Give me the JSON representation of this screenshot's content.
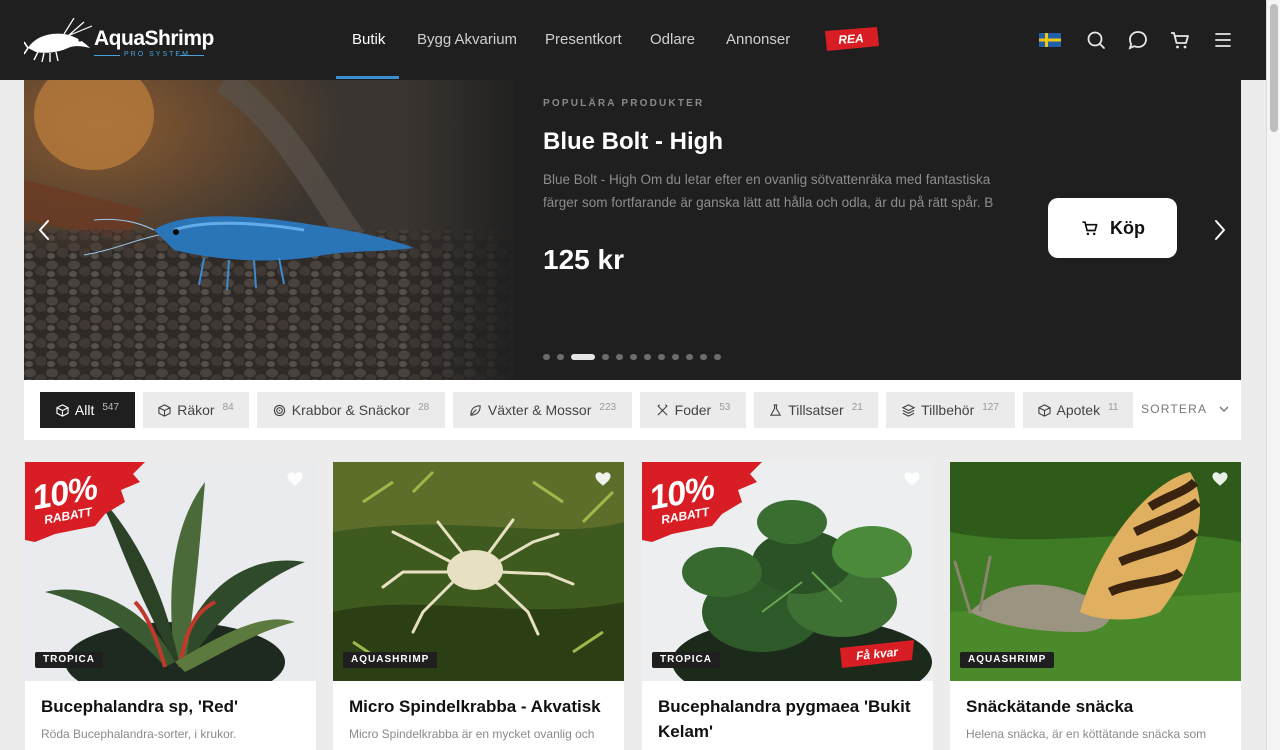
{
  "brand": {
    "name": "AquaShrimp",
    "subtitle": "PRO SYSTEM"
  },
  "nav": [
    {
      "label": "Butik",
      "active": true
    },
    {
      "label": "Bygg Akvarium"
    },
    {
      "label": "Presentkort"
    },
    {
      "label": "Odlare"
    },
    {
      "label": "Annonser"
    }
  ],
  "sale_label": "REA",
  "header_icons": [
    "swedish-flag-icon",
    "search-icon",
    "chat-icon",
    "cart-icon",
    "menu-icon"
  ],
  "hero": {
    "eyebrow": "POPULÄRA PRODUKTER",
    "title": "Blue Bolt - High",
    "description": "Blue Bolt - High Om du letar efter en ovanlig sötvattenräka med fantastiska färger som fortfarande är ganska lätt att hålla och odla, är du på rätt spår. B",
    "price": "125 kr",
    "buy_label": "Köp",
    "slide_count": 12,
    "active_slide": 3
  },
  "filters": [
    {
      "label": "Allt",
      "count": "547",
      "icon": "box-icon",
      "active": true
    },
    {
      "label": "Räkor",
      "count": "84",
      "icon": "box-icon"
    },
    {
      "label": "Krabbor & Snäckor",
      "count": "28",
      "icon": "spiral-icon"
    },
    {
      "label": "Växter & Mossor",
      "count": "223",
      "icon": "leaf-icon"
    },
    {
      "label": "Foder",
      "count": "53",
      "icon": "utensils-icon"
    },
    {
      "label": "Tillsatser",
      "count": "21",
      "icon": "flask-icon"
    },
    {
      "label": "Tillbehör",
      "count": "127",
      "icon": "layers-icon"
    },
    {
      "label": "Apotek",
      "count": "11",
      "icon": "box-icon"
    }
  ],
  "sort_label": "SORTERA",
  "products": [
    {
      "title": "Bucephalandra sp, 'Red'",
      "description": "Röda Bucephalandra-sorter, i krukor.",
      "brand": "TROPICA",
      "discount": {
        "line1": "10%",
        "line2": "RABATT"
      }
    },
    {
      "title": "Micro Spindelkrabba - Akvatisk",
      "description": "Micro Spindelkrabba är en mycket ovanlig och",
      "brand": "AQUASHRIMP"
    },
    {
      "title": "Bucephalandra pygmaea 'Bukit Kelam'",
      "description": "",
      "brand": "TROPICA",
      "discount": {
        "line1": "10%",
        "line2": "RABATT"
      },
      "badge": "Få kvar"
    },
    {
      "title": "Snäckätande snäcka",
      "description": "Helena snäcka, är en köttätande snäcka som",
      "brand": "AQUASHRIMP"
    }
  ],
  "colors": {
    "header_bg": "#1f1f1f",
    "accent_blue": "#3b8fd0",
    "sale_red": "#d81e24"
  }
}
